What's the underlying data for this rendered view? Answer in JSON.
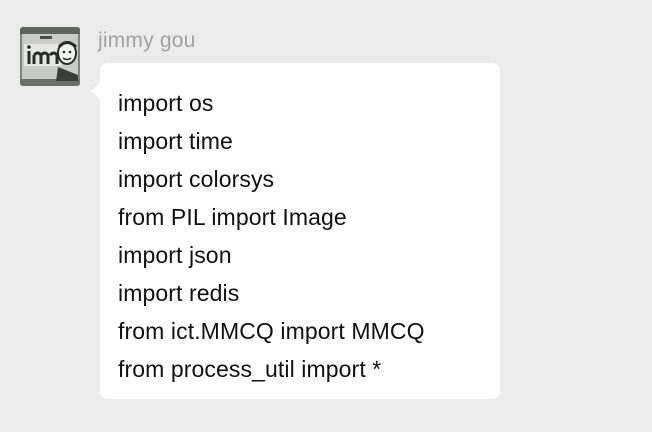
{
  "message": {
    "sender": "jimmy gou",
    "avatar_icon": "user-avatar-icon",
    "bubble_color": "#ffffff",
    "background_color": "#ececec",
    "lines": [
      "import os",
      "import time",
      "import colorsys",
      "from PIL import Image",
      "import json",
      "import redis",
      "from ict.MMCQ import MMCQ",
      "from process_util import *"
    ]
  }
}
